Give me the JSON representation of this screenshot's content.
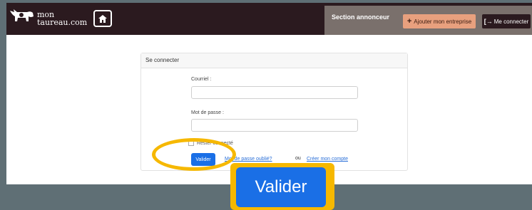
{
  "header": {
    "logo_line1": "mon",
    "logo_line2": "taureau.com",
    "home_icon": "home-icon",
    "section_title": "Section annonceur",
    "add_business_label": "Ajouter mon entreprise",
    "login_label": "Me connecter",
    "colors": {
      "bar": "#2b1a1f",
      "section": "#7a706c",
      "add_btn": "#e8a07e"
    }
  },
  "login": {
    "card_title": "Se connecter",
    "email_label": "Courriel :",
    "email_value": "",
    "password_label": "Mot de passe :",
    "password_value": "",
    "remember_label": "Rester connecté",
    "submit_label": "Valider",
    "forgot_label": "Mot de passe oublié?",
    "or_label": "ou",
    "create_label": "Créer mon compte"
  },
  "callout": {
    "zoom_label": "Valider",
    "highlight_color": "#f6b800",
    "button_color": "#1a6fe6"
  }
}
